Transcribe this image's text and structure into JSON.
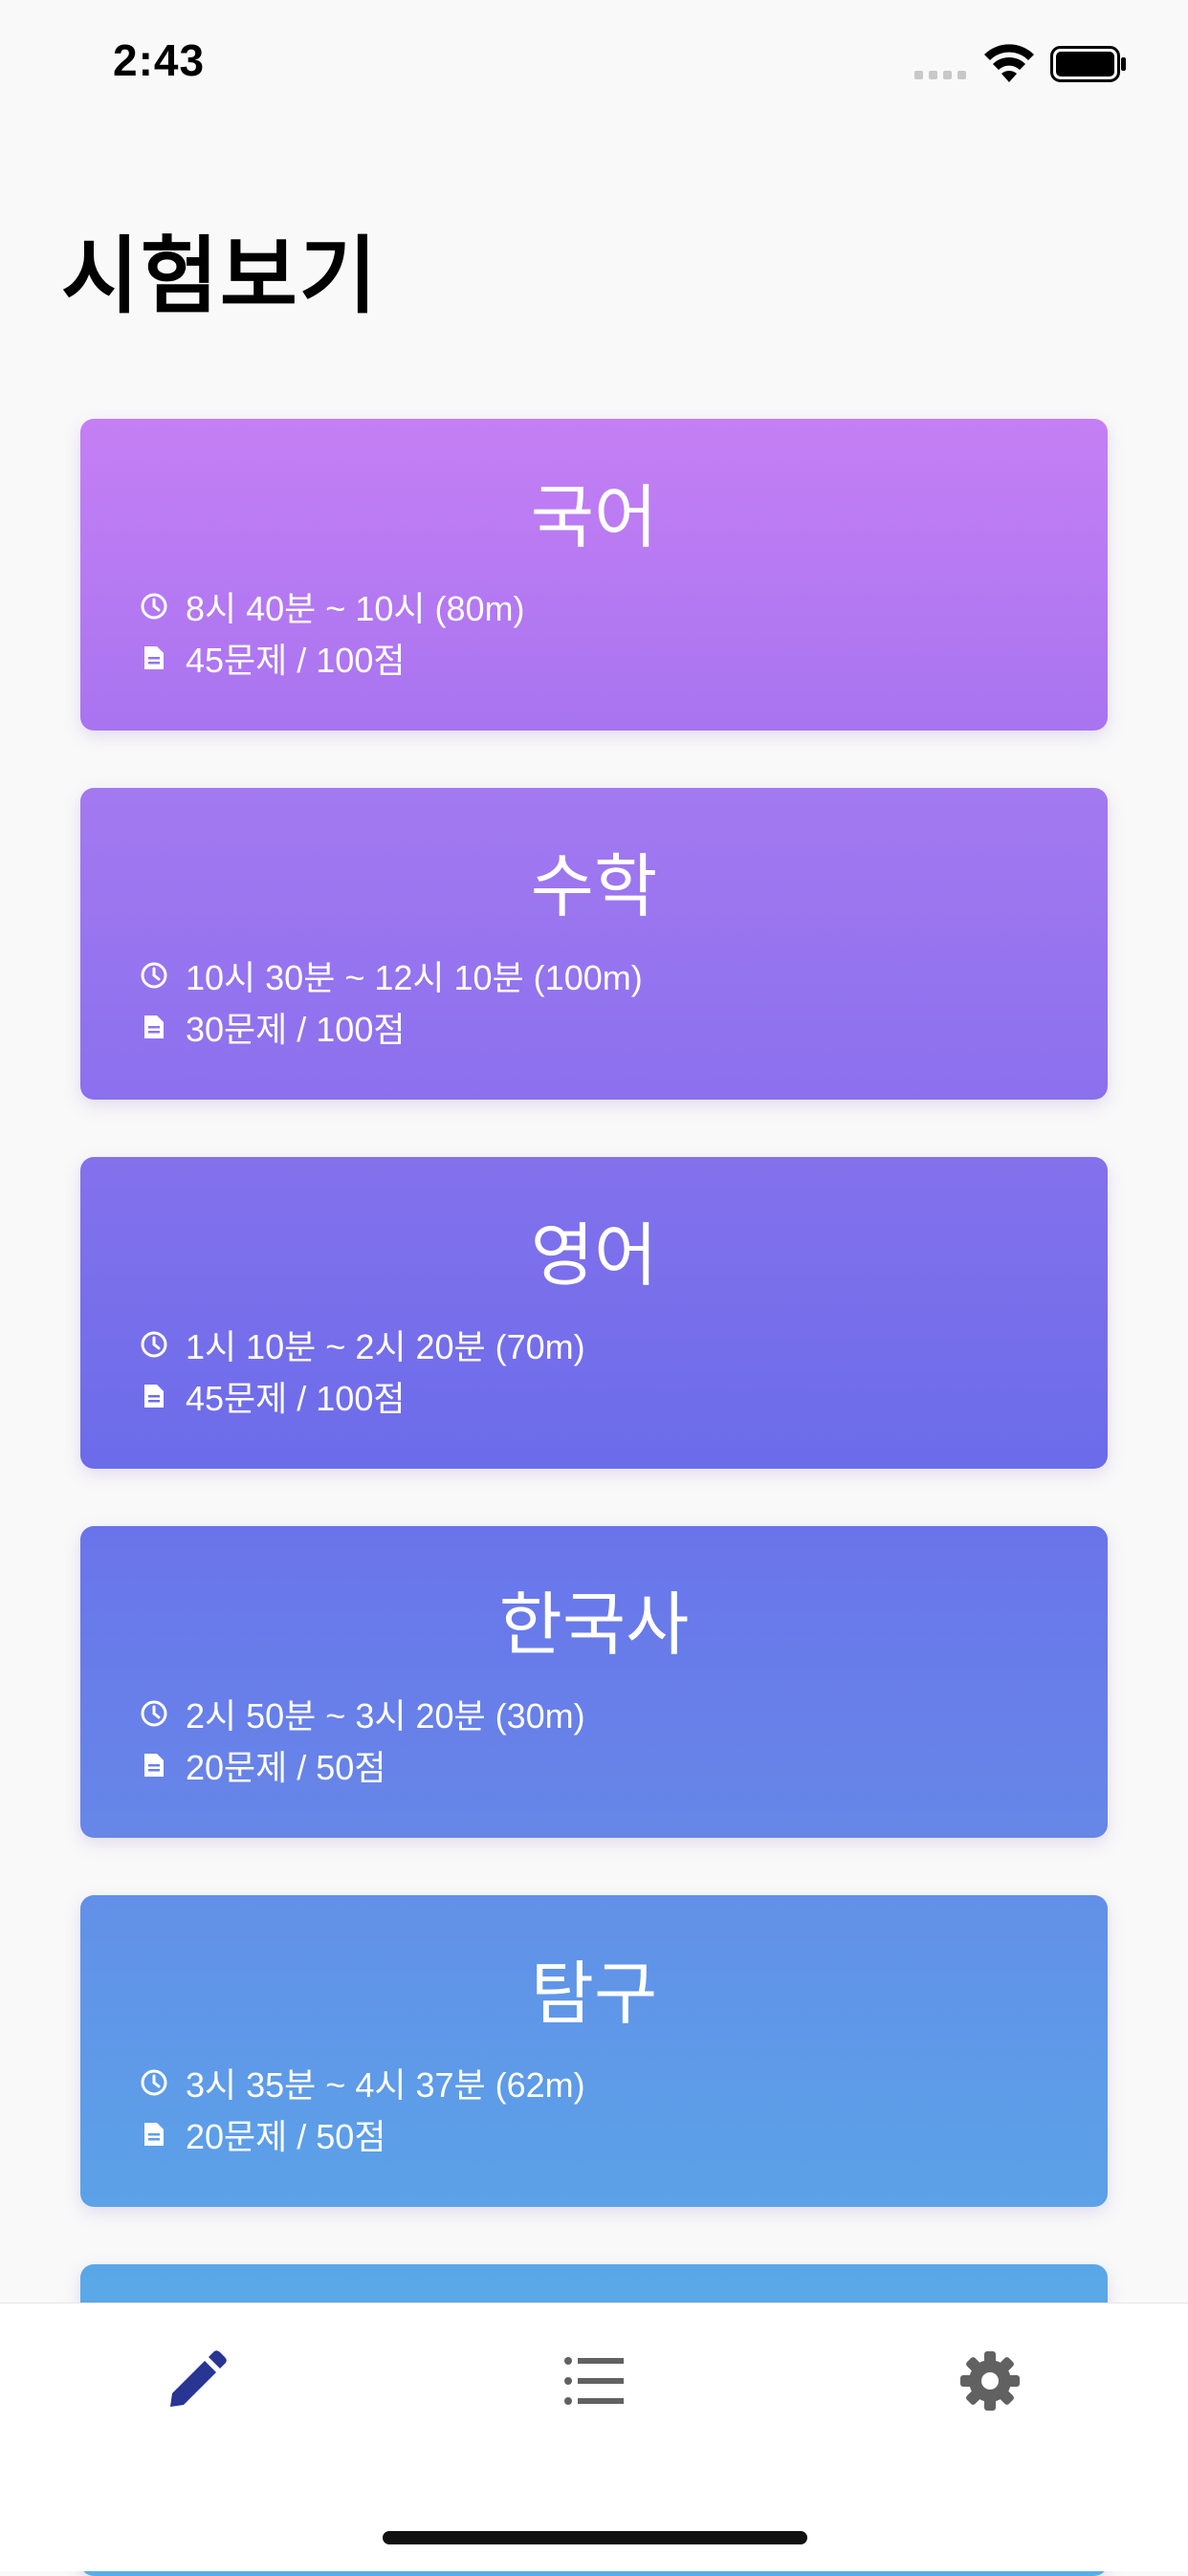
{
  "status_bar": {
    "time": "2:43"
  },
  "page": {
    "title": "시험보기"
  },
  "exams": [
    {
      "subject": "국어",
      "time": "8시 40분 ~ 10시 (80m)",
      "questions": "45문제 / 100점",
      "gradient": [
        "#c57ff4",
        "#a874f0"
      ]
    },
    {
      "subject": "수학",
      "time": "10시 30분 ~ 12시 10분 (100m)",
      "questions": "30문제 / 100점",
      "gradient": [
        "#a479f0",
        "#8b70ee"
      ]
    },
    {
      "subject": "영어",
      "time": "1시 10분 ~ 2시 20분 (70m)",
      "questions": "45문제 / 100점",
      "gradient": [
        "#8471ec",
        "#6b6cea"
      ]
    },
    {
      "subject": "한국사",
      "time": "2시 50분 ~ 3시 20분 (30m)",
      "questions": "20문제 / 50점",
      "gradient": [
        "#6a74ea",
        "#6687e8"
      ]
    },
    {
      "subject": "탐구",
      "time": "3시 35분 ~ 4시 37분 (62m)",
      "questions": "20문제 / 50점",
      "gradient": [
        "#6290e8",
        "#5ba2e8"
      ]
    },
    {
      "subject": "",
      "time": "",
      "questions": "",
      "gradient": [
        "#5aa7e8",
        "#56b0e8"
      ]
    }
  ],
  "tab_bar": {
    "active_color": "#283593",
    "inactive_color": "#616161",
    "tabs": [
      {
        "icon": "pencil-icon",
        "active": true
      },
      {
        "icon": "list-icon",
        "active": false
      },
      {
        "icon": "gear-icon",
        "active": false
      }
    ]
  }
}
